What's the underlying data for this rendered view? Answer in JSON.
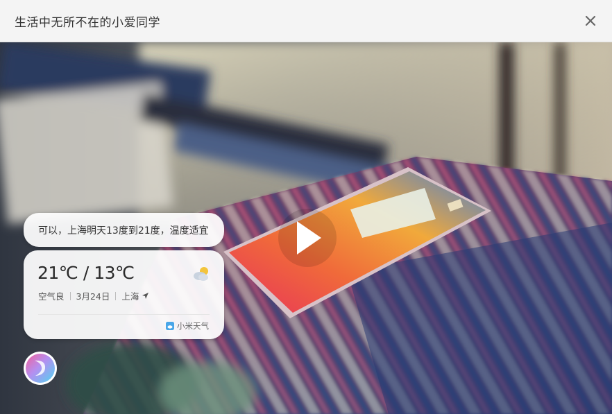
{
  "header": {
    "title": "生活中无所不在的小爱同学"
  },
  "video": {
    "bubble_text": "可以，上海明天13度到21度，温度适宜",
    "weather": {
      "temperature": "21℃ / 13℃",
      "air_quality": "空气良",
      "date": "3月24日",
      "city": "上海",
      "brand": "小米天气"
    }
  },
  "icons": {
    "close": "close-icon",
    "play": "play-icon",
    "weather": "partly-cloudy-icon",
    "location": "location-arrow-icon",
    "brand": "xiaomi-weather-icon",
    "assistant": "xiaoai-avatar-icon"
  }
}
